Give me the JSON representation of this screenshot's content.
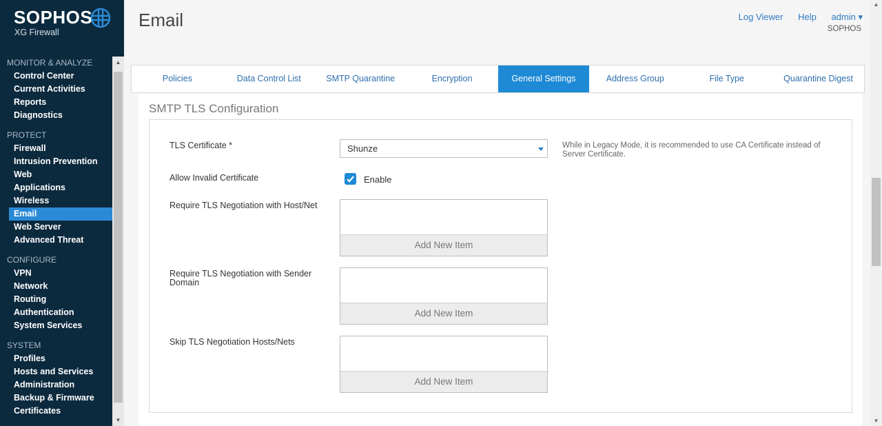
{
  "brand": {
    "name": "SOPHOS",
    "product": "XG Firewall"
  },
  "header": {
    "title": "Email",
    "links": {
      "log_viewer": "Log Viewer",
      "help": "Help",
      "user": "admin ▾"
    },
    "org": "SOPHOS"
  },
  "sidebar": {
    "sections": [
      {
        "title": "MONITOR & ANALYZE",
        "items": [
          "Control Center",
          "Current Activities",
          "Reports",
          "Diagnostics"
        ]
      },
      {
        "title": "PROTECT",
        "items": [
          "Firewall",
          "Intrusion Prevention",
          "Web",
          "Applications",
          "Wireless",
          "Email",
          "Web Server",
          "Advanced Threat"
        ]
      },
      {
        "title": "CONFIGURE",
        "items": [
          "VPN",
          "Network",
          "Routing",
          "Authentication",
          "System Services"
        ]
      },
      {
        "title": "SYSTEM",
        "items": [
          "Profiles",
          "Hosts and Services",
          "Administration",
          "Backup & Firmware",
          "Certificates"
        ]
      }
    ],
    "active_item": "Email"
  },
  "tabs": [
    {
      "label": "Policies",
      "active": false
    },
    {
      "label": "Data Control List",
      "active": false
    },
    {
      "label": "SMTP Quarantine",
      "active": false
    },
    {
      "label": "Encryption",
      "active": false
    },
    {
      "label": "General Settings",
      "active": true
    },
    {
      "label": "Address Group",
      "active": false
    },
    {
      "label": "File Type",
      "active": false
    },
    {
      "label": "Quarantine Digest",
      "active": false
    }
  ],
  "smtp_tls": {
    "section_title": "SMTP TLS Configuration",
    "tls_certificate": {
      "label": "TLS Certificate *",
      "value": "Shunze",
      "hint": "While in Legacy Mode, it is recommended to use CA Certificate instead of Server Certificate."
    },
    "allow_invalid": {
      "label": "Allow Invalid Certificate",
      "checkbox_label": "Enable",
      "checked": true
    },
    "require_host": {
      "label": "Require TLS Negotiation with Host/Net",
      "add_label": "Add New Item"
    },
    "require_sender": {
      "label": "Require TLS Negotiation with Sender Domain",
      "add_label": "Add New Item"
    },
    "skip_hosts": {
      "label": "Skip TLS Negotiation Hosts/Nets",
      "add_label": "Add New Item"
    }
  },
  "colors": {
    "sidebar_bg": "#0c2a3e",
    "accent": "#1e8ad6",
    "link": "#2e7ac2"
  }
}
